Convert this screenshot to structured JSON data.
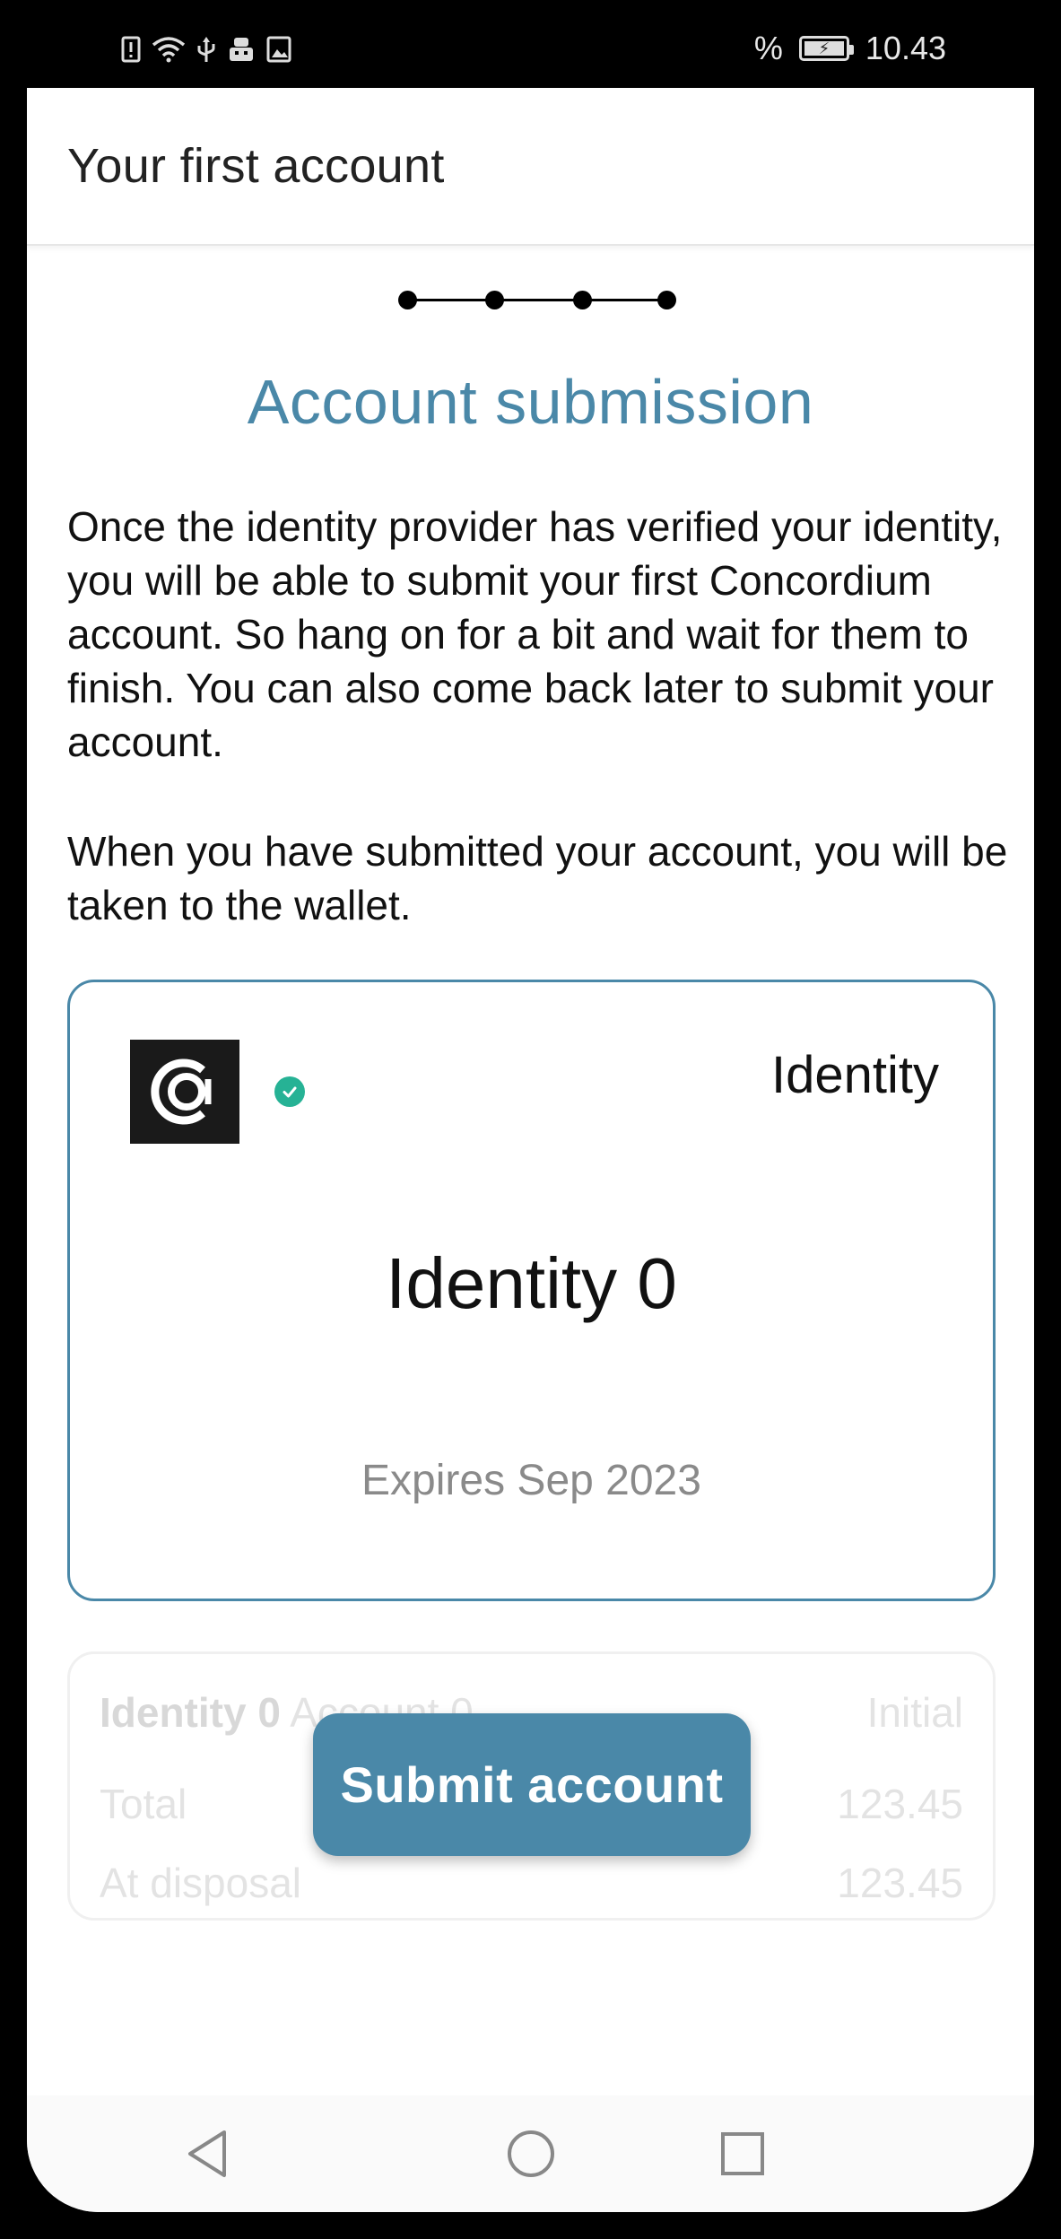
{
  "status_bar": {
    "icons": [
      "alert-icon",
      "wifi-icon",
      "usb-icon",
      "app-icon",
      "image-icon"
    ],
    "battery_percent_label": "%",
    "time": "10.43"
  },
  "app_bar": {
    "title": "Your first account"
  },
  "stepper": {
    "steps": 4
  },
  "content": {
    "heading": "Account submission",
    "paragraph1": "Once the identity provider has verified your identity, you will be able to submit your first Concordium account. So hang on for a bit and wait for them to finish. You can also come back later to submit your account.",
    "paragraph2": "When you have submitted your account, you will be taken to the wallet."
  },
  "identity_card": {
    "type_label": "Identity",
    "name": "Identity 0",
    "expiry": "Expires Sep 2023",
    "status_icon": "check-circle-icon",
    "accent_color": "#4a88a8",
    "status_color": "#26b295"
  },
  "account_card": {
    "identity_label": "Identity 0",
    "account_label": "Account 0",
    "state_label": "Initial",
    "total_label": "Total",
    "total_value": "123.45",
    "disposal_label": "At disposal",
    "disposal_value": "123.45"
  },
  "actions": {
    "submit_label": "Submit account"
  },
  "nav_bar": {
    "buttons": [
      "back-icon",
      "home-icon",
      "recents-icon"
    ]
  }
}
